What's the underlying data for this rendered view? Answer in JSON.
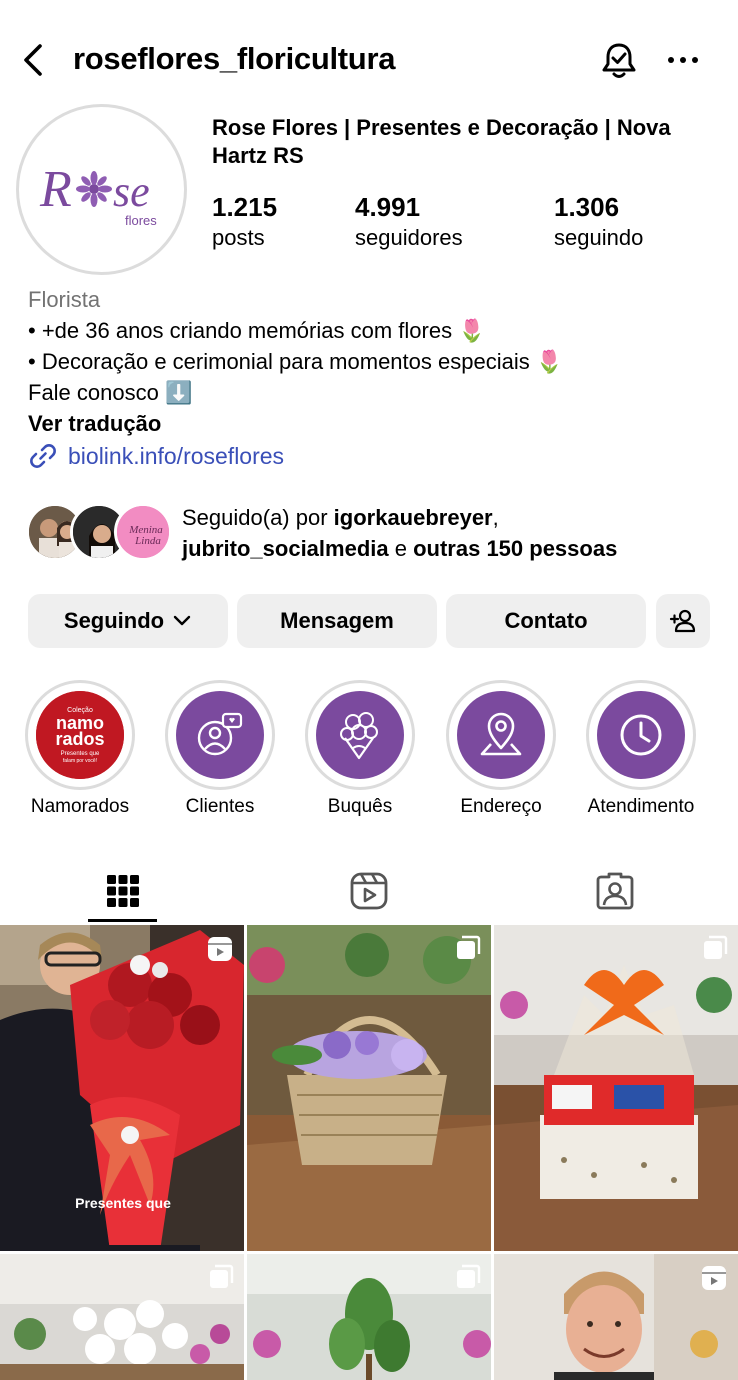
{
  "header": {
    "username": "roseflores_floricultura",
    "back_icon": "chevron-left-icon",
    "notification_icon": "bell-check-icon",
    "more_icon": "ellipsis-icon"
  },
  "profile": {
    "avatar_text": "Rose",
    "avatar_subtext": "flores",
    "full_name": "Rose Flores | Presentes e Decoração | Nova Hartz RS",
    "stats": [
      {
        "value": "1.215",
        "label": "posts"
      },
      {
        "value": "4.991",
        "label": "seguidores"
      },
      {
        "value": "1.306",
        "label": "seguindo"
      }
    ],
    "category": "Florista",
    "bio_lines": [
      "• +de 36 anos criando memórias com flores 🌷",
      "• Decoração e cerimonial para momentos especiais 🌷",
      "Fale conosco ⬇️"
    ],
    "translate": "Ver tradução",
    "link": "biolink.info/roseflores"
  },
  "mutuals": {
    "prefix": "Seguido(a) por ",
    "user1": "igorkauebreyer",
    "comma": ",",
    "user2": "jubrito_socialmedia",
    "conj": " e ",
    "others": "outras 150 pessoas",
    "third_avatar_text1": "Menina",
    "third_avatar_text2": "Linda"
  },
  "actions": {
    "following": "Seguindo",
    "message": "Mensagem",
    "contact": "Contato",
    "add_icon": "add-person-icon"
  },
  "highlights": [
    {
      "label": "Namorados",
      "cover_line1": "Coleção",
      "cover_line2": "namo",
      "cover_line3": "rados",
      "cover_line4": "Presentes que",
      "cover_line5": "falam por você!"
    },
    {
      "label": "Clientes",
      "icon": "clients-chat-icon"
    },
    {
      "label": "Buquês",
      "icon": "bouquet-icon"
    },
    {
      "label": "Endereço",
      "icon": "location-pin-icon"
    },
    {
      "label": "Atendimento",
      "icon": "clock-icon"
    }
  ],
  "tabs": [
    "grid-tab",
    "reels-tab",
    "tagged-tab"
  ],
  "colors": {
    "brand_purple": "#7b4a9e",
    "link_blue": "#3a4fb8",
    "button_gray": "#efefef",
    "secondary_text": "#737373"
  },
  "grid": {
    "post1_caption": "Presentes que"
  }
}
